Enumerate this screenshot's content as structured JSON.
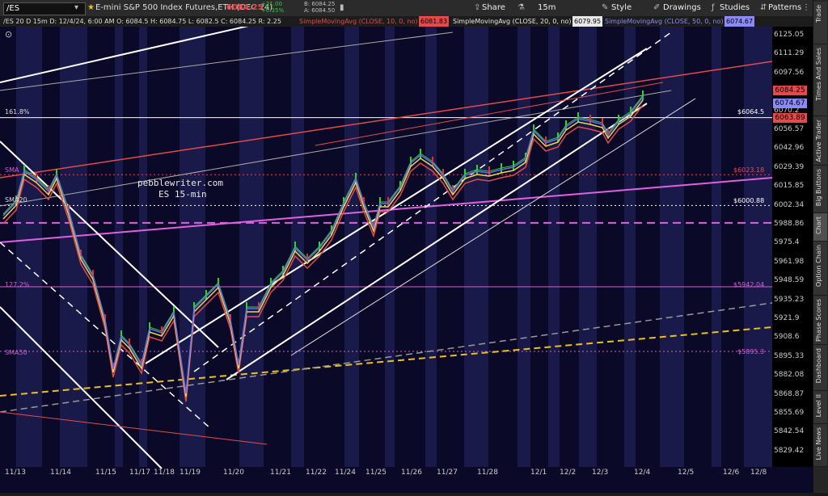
{
  "toolbar": {
    "symbol": "/ES",
    "description": "E-mini S&P 500 Index Futures,ETH (DEC 24)",
    "last": "6084.25",
    "change_up": "+21.00",
    "change_pct": "+0.35%",
    "bid": "B: 6084.25",
    "ask": "A: 6084.50",
    "share_label": "Share",
    "style_label": "Style",
    "drawings_label": "Drawings",
    "studies_label": "Studies",
    "patterns_label": "Patterns",
    "timeframe": "15m"
  },
  "study_bar": {
    "ohlc": "/ES 20 D 15m  D: 12/4/24, 6:00 AM  O: 6084.5  H: 6084.75  L: 6082.5  C: 6084.25  R: 2.25",
    "sma10": "SimpleMovingAvg (CLOSE, 10, 0, no)",
    "sma10_val": "6081.83",
    "sma20": "SimpleMovingAvg (CLOSE, 20, 0, no)",
    "sma20_val": "6079.95",
    "sma50": "SimpleMovingAvg (CLOSE, 50, 0, no)",
    "sma50_val": "6074.67"
  },
  "annotation": {
    "site": "pebblewriter.com",
    "subtitle": "ES 15-min"
  },
  "levels": {
    "fib1618": "161.8%",
    "fib1272": "127.2%",
    "sma_label": "SMA50",
    "sma_left1": "SMA",
    "sma_left2": "SMA20",
    "r6064": "$6064.5",
    "r6023": "$6023.18",
    "r6000": "$6000.88",
    "r5942": "$5942.04",
    "r5895": "$5895.3"
  },
  "price_axis": [
    "6125.05",
    "6111.29",
    "6097.56",
    "6083.81",
    "6070.2",
    "6056.57",
    "6042.96",
    "6029.39",
    "6015.85",
    "6002.34",
    "5988.86",
    "5975.4",
    "5961.98",
    "5948.59",
    "5935.23",
    "5921.9",
    "5908.6",
    "5895.33",
    "5882.08",
    "5868.87",
    "5855.69",
    "5842.54",
    "5829.42"
  ],
  "price_tags": {
    "last": "6084.25",
    "sma50": "6074.67",
    "other": "6063.89"
  },
  "dates": [
    "11/13",
    "11/14",
    "11/15",
    "11/17",
    "11/18",
    "11/19",
    "11/20",
    "11/21",
    "11/22",
    "11/24",
    "11/25",
    "11/26",
    "11/27",
    "11/28",
    "12/1",
    "12/2",
    "12/3",
    "12/4",
    "12/5",
    "12/6",
    "12/8"
  ],
  "sidebar_tabs": [
    "Trade",
    "Times And Sales",
    "Active Trader",
    "Big Buttons",
    "Chart",
    "Option Chain",
    "Phase Scores",
    "Dashboard",
    "Level II",
    "Live News"
  ],
  "colors": {
    "chart_bg": "#0a0a28",
    "band": "#1a1a4a",
    "sma10": "#e34b4b",
    "sma20": "#e8d84b",
    "sma50": "#6a6af0",
    "up": "#2ad42a",
    "down": "#e03030"
  }
}
